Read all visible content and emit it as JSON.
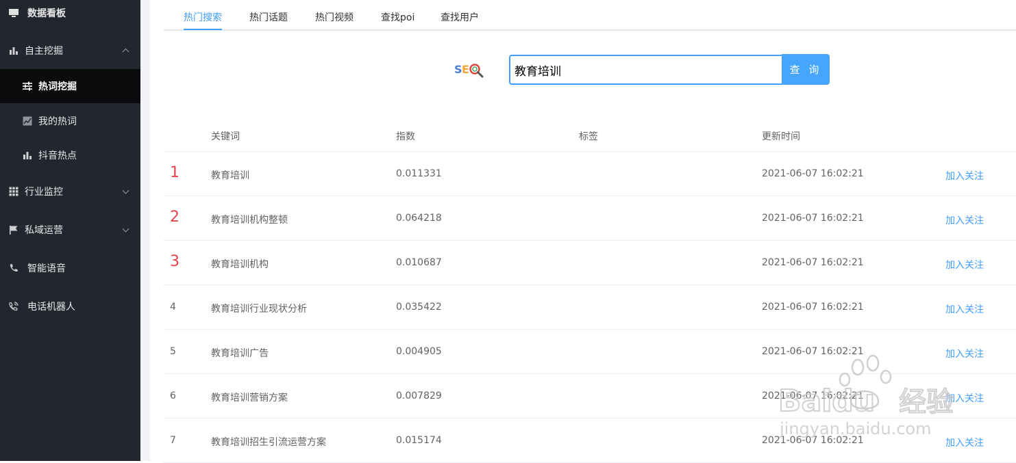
{
  "sidebar": {
    "items": [
      {
        "label": "数据看板",
        "icon": "monitor-icon"
      },
      {
        "label": "自主挖掘",
        "icon": "bar-chart-icon"
      },
      {
        "label": "热词挖掘",
        "icon": "sliders-icon"
      },
      {
        "label": "我的热词",
        "icon": "trend-chart-icon"
      },
      {
        "label": "抖音热点",
        "icon": "bar-chart-icon"
      },
      {
        "label": "行业监控",
        "icon": "grid-icon"
      },
      {
        "label": "私域运营",
        "icon": "flag-icon"
      },
      {
        "label": "智能语音",
        "icon": "phone-icon"
      },
      {
        "label": "电话机器人",
        "icon": "phone-ring-icon"
      }
    ]
  },
  "tabs": [
    "热门搜索",
    "热门话题",
    "热门视频",
    "查找poi",
    "查找用户"
  ],
  "search": {
    "logo_text": "SEO",
    "value": "教育培训",
    "button_label": "查 询"
  },
  "table": {
    "headers": {
      "keyword": "关键词",
      "index": "指数",
      "tag": "标签",
      "updated": "更新时间"
    },
    "rows": [
      {
        "rank": "1",
        "keyword": "教育培训",
        "index": "0.011331",
        "tag": "",
        "updated": "2021-06-07 16:02:21",
        "action": "加入关注"
      },
      {
        "rank": "2",
        "keyword": "教育培训机构整顿",
        "index": "0.064218",
        "tag": "",
        "updated": "2021-06-07 16:02:21",
        "action": "加入关注"
      },
      {
        "rank": "3",
        "keyword": "教育培训机构",
        "index": "0.010687",
        "tag": "",
        "updated": "2021-06-07 16:02:21",
        "action": "加入关注"
      },
      {
        "rank": "4",
        "keyword": "教育培训行业现状分析",
        "index": "0.035422",
        "tag": "",
        "updated": "2021-06-07 16:02:21",
        "action": "加入关注"
      },
      {
        "rank": "5",
        "keyword": "教育培训广告",
        "index": "0.004905",
        "tag": "",
        "updated": "2021-06-07 16:02:21",
        "action": "加入关注"
      },
      {
        "rank": "6",
        "keyword": "教育培训营销方案",
        "index": "0.007829",
        "tag": "",
        "updated": "2021-06-07 16:02:21",
        "action": "加入关注"
      },
      {
        "rank": "7",
        "keyword": "教育培训招生引流运营方案",
        "index": "0.015174",
        "tag": "",
        "updated": "2021-06-07 16:02:21",
        "action": "加入关注"
      }
    ]
  },
  "watermark": {
    "brand": "Baidu",
    "brand_cn": "经验",
    "url": "jingyan.baidu.com"
  },
  "colors": {
    "accent": "#409eff",
    "rank_top": "#e5434b",
    "sidebar_bg": "#22262e"
  }
}
